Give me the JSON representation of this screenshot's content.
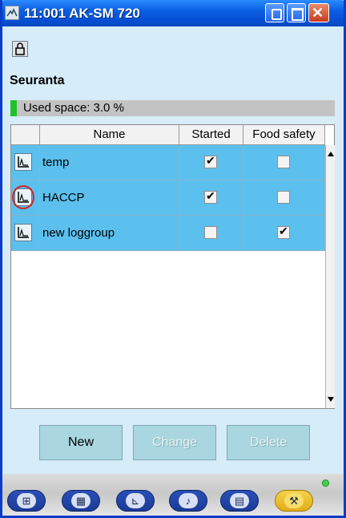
{
  "window": {
    "title": "11:001 AK-SM 720"
  },
  "page": {
    "heading": "Seuranta",
    "used_space_label": "Used space: 3.0 %",
    "used_space_percent": 3.0
  },
  "table": {
    "columns": [
      "",
      "Name",
      "Started",
      "Food safety"
    ],
    "rows": [
      {
        "name": "temp",
        "started": true,
        "food_safety": false
      },
      {
        "name": "HACCP",
        "started": true,
        "food_safety": false
      },
      {
        "name": "new loggroup",
        "started": false,
        "food_safety": true
      }
    ]
  },
  "buttons": {
    "new_label": "New",
    "change_label": "Change",
    "delete_label": "Delete"
  },
  "taskbar": {
    "items": [
      "tree-icon",
      "grid-icon",
      "graph-icon",
      "alarm-icon",
      "notes-icon",
      "wrench-icon"
    ],
    "active": "wrench-icon"
  },
  "colors": {
    "titlebar": "#0a5fe0",
    "selection_row": "#5cc0ee",
    "usage_fill": "#1ec32a",
    "button": "#a9d6df"
  }
}
